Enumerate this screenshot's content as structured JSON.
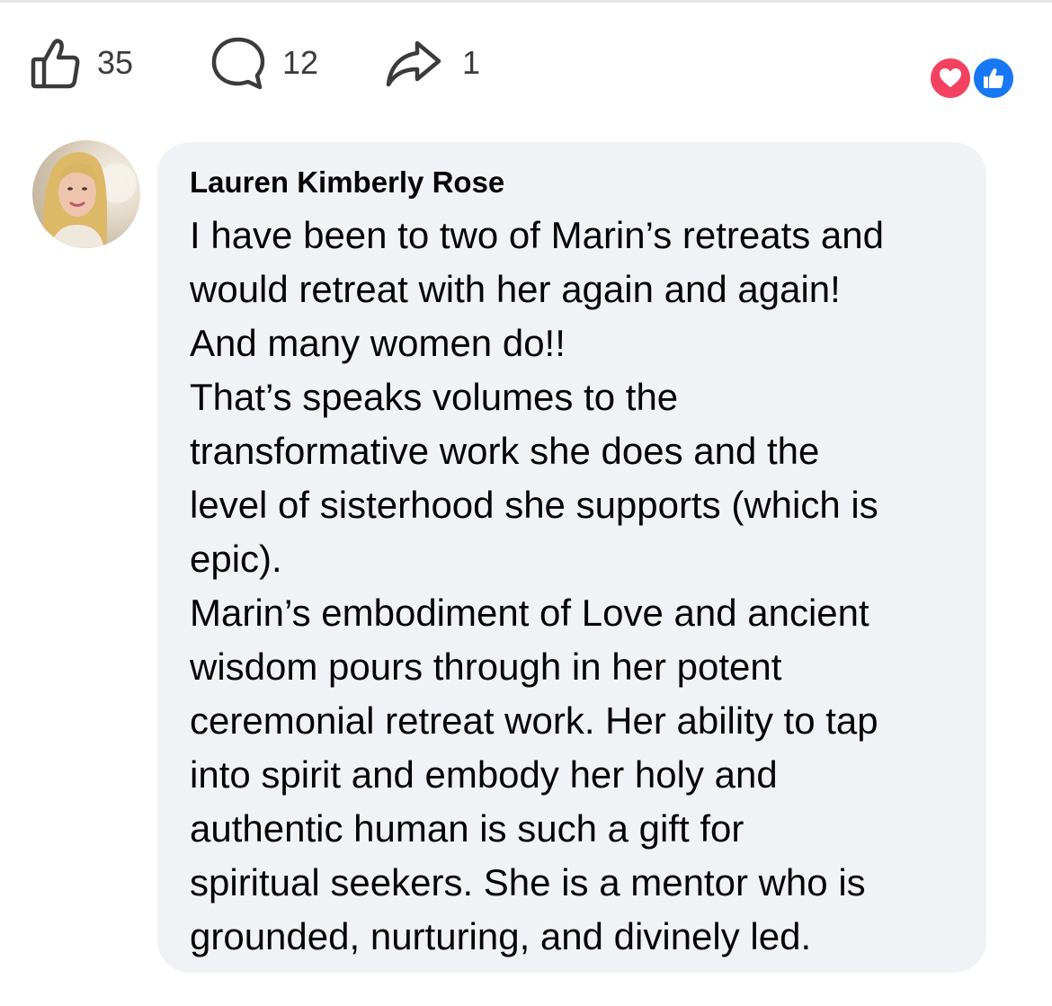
{
  "actions": {
    "like": {
      "icon": "thumbs-up-icon",
      "count": "35"
    },
    "comment": {
      "icon": "comment-bubble-icon",
      "count": "12"
    },
    "share": {
      "icon": "share-arrow-icon",
      "count": "1"
    }
  },
  "reactions": [
    {
      "icon": "heart-icon",
      "color": "#f3425f"
    },
    {
      "icon": "thumbs-up-icon",
      "color": "#1877f2"
    }
  ],
  "comment": {
    "author": "Lauren Kimberly Rose",
    "lines": [
      "I have been to two of Marin’s retreats and",
      "would retreat with her again and again!",
      "And many women do!!",
      "That’s speaks volumes to the",
      "transformative work she does and the",
      "level of sisterhood she supports (which is",
      "epic).",
      "Marin’s embodiment of Love and ancient",
      "wisdom pours through in her potent",
      "ceremonial retreat work. Her ability to tap",
      "into spirit and embody her holy and",
      "authentic human is such a gift for",
      "spiritual seekers. She is a mentor who is",
      "grounded, nurturing, and divinely led."
    ]
  },
  "colors": {
    "bubble": "#f0f2f5",
    "text": "#050505",
    "icon": "#3a3b3c",
    "love": "#f3425f",
    "like": "#1877f2"
  }
}
